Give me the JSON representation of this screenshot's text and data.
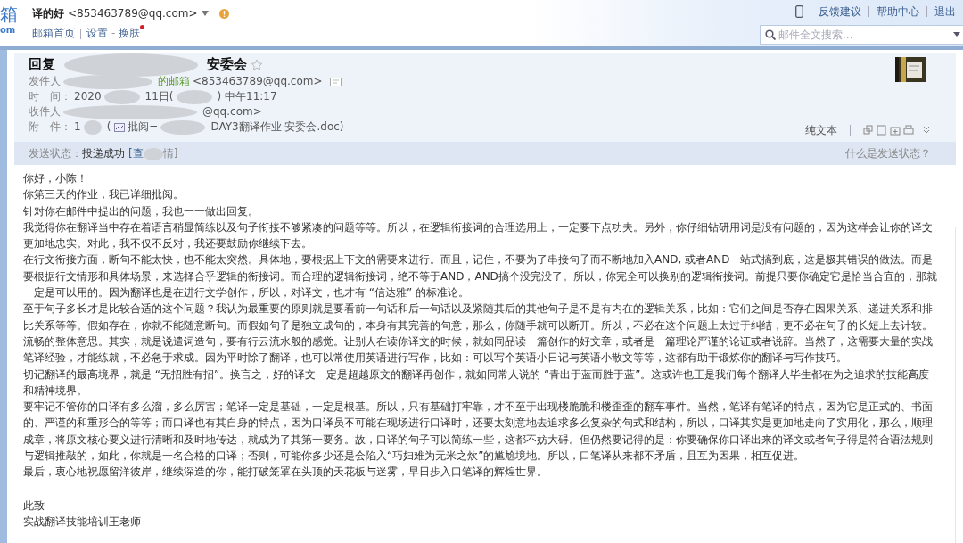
{
  "header": {
    "logo": [
      "箱",
      "om"
    ],
    "account": {
      "name": "译的好",
      "email": "<853463789@qq.com>"
    },
    "links": [
      {
        "kind": "link",
        "text": "邮箱首页"
      },
      {
        "kind": "link",
        "text": "设置"
      },
      {
        "kind": "sep",
        "text": "-"
      },
      {
        "kind": "link",
        "text": "换肤"
      }
    ],
    "skin_new": true,
    "top_links": [
      "反馈建议",
      "帮助中心",
      "退出"
    ],
    "search": {
      "placeholder": "邮件全文搜索..."
    }
  },
  "mail": {
    "subject": [
      "回复",
      "安委会"
    ],
    "starred": false,
    "fields": [
      {
        "label": "发件人",
        "parts": [
          {
            "text": "的邮箱",
            "kind": "name"
          },
          {
            "text": "<853463789@qq.com>",
            "kind": "plain"
          }
        ]
      },
      {
        "label": "时　间：",
        "parts": [
          {
            "text": "2020",
            "kind": "plain"
          },
          {
            "text": "11日(",
            "kind": "plain"
          },
          {
            "text": ") 中午11:17",
            "kind": "plain"
          }
        ]
      },
      {
        "label": "收件人",
        "parts": [
          {
            "text": "@qq.com>",
            "kind": "plain"
          }
        ]
      },
      {
        "label": "附　件：",
        "parts": [
          {
            "text": "1",
            "kind": "plain"
          },
          {
            "text": "(",
            "kind": "plain"
          },
          {
            "text": "批阅=",
            "kind": "file"
          },
          {
            "text": "DAY3翻译作业 安委会.doc)",
            "kind": "plain"
          }
        ]
      }
    ],
    "view_mode": "纯文本",
    "status": {
      "label": "发送状态：",
      "value": "投递成功",
      "detail": [
        "[查",
        "情]"
      ],
      "help": "什么是发送状态？"
    },
    "body": [
      "你好，小陈！",
      "你第三天的作业，我已详细批阅。",
      "针对你在邮件中提出的问题，我也一一做出回复。",
      "我觉得你在翻译当中存在着语言稍显简练以及句子衔接不够紧凑的问题等等。所以，在逻辑衔接词的合理选用上，一定要下点功夫。另外，你仔细钻研用词是没有问题的，因为这样会让你的译文更加地忠实。对此，我不仅不反对，我还要鼓励你继续下去。",
      "在行文衔接方面，断句不能太快，也不能太突然。具体地，要根据上下文的需要来进行。而且，记住，不要为了串接句子而不断地加入AND, 或者AND一站式搞到底，这是极其错误的做法。而是要根据行文情形和具体场景，来选择合乎逻辑的衔接词。而合理的逻辑衔接词，绝不等于AND，AND搞个没完没了。所以，你完全可以换别的逻辑衔接词。前提只要你确定它是恰当合宜的，那就一定是可以用的。因为翻译也是在进行文学创作，所以，对译文，也才有 “信达雅” 的标准论。",
      "至于句子多长才是比较合适的这个问题？我认为最重要的原则就是要看前一句话和后一句话以及紧随其后的其他句子是不是有内在的逻辑关系，比如：它们之间是否存在因果关系、递进关系和排比关系等等。假如存在，你就不能随意断句。而假如句子是独立成句的，本身有其完善的句意，那么，你随手就可以断开。所以，不必在这个问题上太过于纠结，更不必在句子的长短上去计较。",
      "流畅的整体意思。其实，就是说遣词造句，要有行云流水般的感觉。让别人在读你译文的时候，就如同品读一篇创作的好文章，或者是一篇理论严谨的论证或者说辞。当然了，这需要大量的实战笔译经验，才能练就，不必急于求成。因为平时除了翻译，也可以常使用英语进行写作，比如：可以写个英语小日记与英语小散文等等，这都有助于锻炼你的翻译与写作技巧。",
      "切记翻译的最高境界，就是 “无招胜有招”。换言之，好的译文一定是超越原文的翻译再创作，就如同常人说的 “青出于蓝而胜于蓝”。这或许也正是我们每个翻译人毕生都在为之追求的技能高度和精神境界。",
      "要牢记不管你的口译有多么溜，多么厉害；笔译一定是基础，一定是根基。所以，只有基础打牢靠，才不至于出现楼脆脆和楼歪歪的翻车事件。当然，笔译有笔译的特点，因为它是正式的、书面的、严谨的和重形合的等等；而口译也有其自身的特点，因为口译员不可能在现场进行口译时，还要太刻意地去追求多么复杂的句式和结构，所以，口译其实是更加地走向了实用化，那么，顺理成章，将原文核心要义进行清晰和及时地传达，就成为了其第一要务。故，口译的句子可以简练一些，这都不妨大碍。但仍然要记得的是：你要确保你口译出来的译文或者句子得是符合语法规则与逻辑推敲的，如此，你就是一名合格的口译；否则，可能你多少还是会陷入“巧妇难为无米之炊”的尴尬境地。所以，口笔译从来都不矛盾，且互为因果，相互促进。",
      "最后，衷心地祝愿留洋彼岸，继续深造的你，能打破笼罩在头顶的天花板与迷雾，早日步入口笔译的辉煌世界。"
    ],
    "closing": [
      "此致",
      "实战翻译技能培训王老师"
    ]
  }
}
